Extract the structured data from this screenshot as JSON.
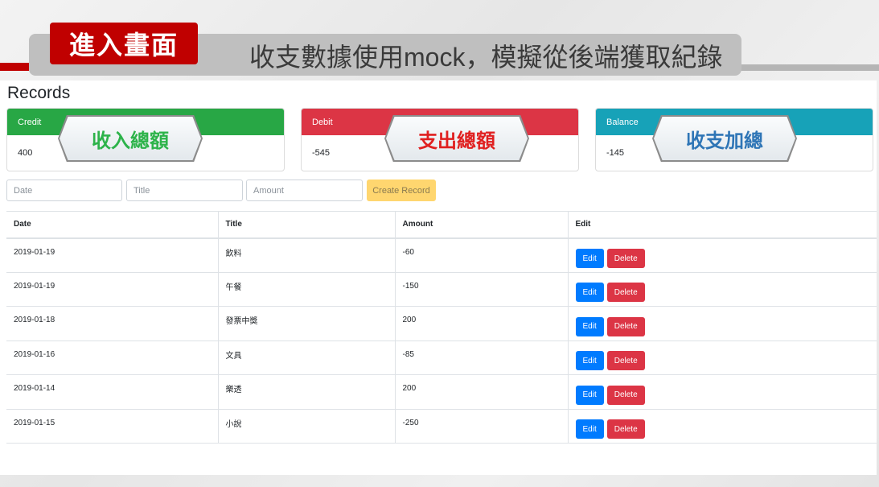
{
  "slide": {
    "tag": "進入畫面",
    "description": "收支數據使用mock，模擬從後端獲取紀錄"
  },
  "app": {
    "title": "Records",
    "cards": [
      {
        "label": "Credit",
        "value": "400",
        "color": "#28a745",
        "callout": "收入總額",
        "callout_color": "#2db34a"
      },
      {
        "label": "Debit",
        "value": "-545",
        "color": "#dc3545",
        "callout": "支出總額",
        "callout_color": "#e02020"
      },
      {
        "label": "Balance",
        "value": "-145",
        "color": "#17a2b8",
        "callout": "收支加總",
        "callout_color": "#2e75b6"
      }
    ],
    "form": {
      "date_placeholder": "Date",
      "title_placeholder": "Title",
      "amount_placeholder": "Amount",
      "create_label": "Create Record"
    },
    "table": {
      "headers": [
        "Date",
        "Title",
        "Amount",
        "Edit"
      ],
      "rows": [
        {
          "date": "2019-01-19",
          "title": "飲料",
          "amount": "-60"
        },
        {
          "date": "2019-01-19",
          "title": "午餐",
          "amount": "-150"
        },
        {
          "date": "2019-01-18",
          "title": "發票中獎",
          "amount": "200"
        },
        {
          "date": "2019-01-16",
          "title": "文具",
          "amount": "-85"
        },
        {
          "date": "2019-01-14",
          "title": "樂透",
          "amount": "200"
        },
        {
          "date": "2019-01-15",
          "title": "小說",
          "amount": "-250"
        }
      ],
      "edit_label": "Edit",
      "delete_label": "Delete"
    }
  }
}
